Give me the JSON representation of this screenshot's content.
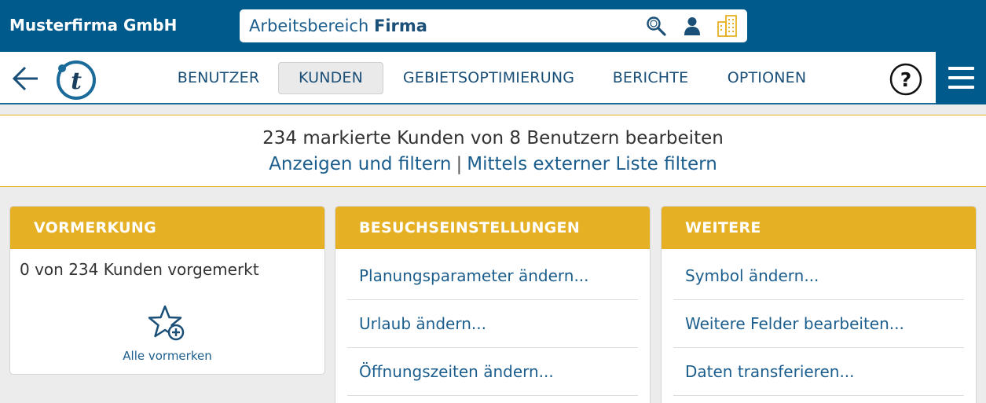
{
  "header": {
    "company": "Musterfirma GmbH",
    "workspace_prefix": "Arbeitsbereich",
    "workspace_name": "Firma",
    "icons": [
      "search-icon",
      "user-icon",
      "building-icon"
    ]
  },
  "nav": {
    "items": [
      {
        "label": "BENUTZER",
        "active": false
      },
      {
        "label": "KUNDEN",
        "active": true
      },
      {
        "label": "GEBIETSOPTIMIERUNG",
        "active": false
      },
      {
        "label": "BERICHTE",
        "active": false
      },
      {
        "label": "OPTIONEN",
        "active": false
      }
    ],
    "help": "?"
  },
  "info": {
    "title": "234 markierte Kunden von 8 Benutzern bearbeiten",
    "link1": "Anzeigen und filtern",
    "separator": "|",
    "link2": "Mittels externer Liste filtern"
  },
  "cards": {
    "vormerkung": {
      "title": "VORMERKUNG",
      "status": "0 von 234 Kunden vorgemerkt",
      "action": "Alle vormerken"
    },
    "besuch": {
      "title": "BESUCHSEINSTELLUNGEN",
      "items": [
        "Planungsparameter ändern...",
        "Urlaub ändern...",
        "Öffnungszeiten ändern..."
      ]
    },
    "weitere": {
      "title": "WEITERE",
      "items": [
        "Symbol ändern...",
        "Weitere Felder bearbeiten...",
        "Daten transferieren..."
      ]
    }
  },
  "colors": {
    "primary": "#005a8c",
    "accent": "#e5b023",
    "link": "#1b5e8e"
  }
}
